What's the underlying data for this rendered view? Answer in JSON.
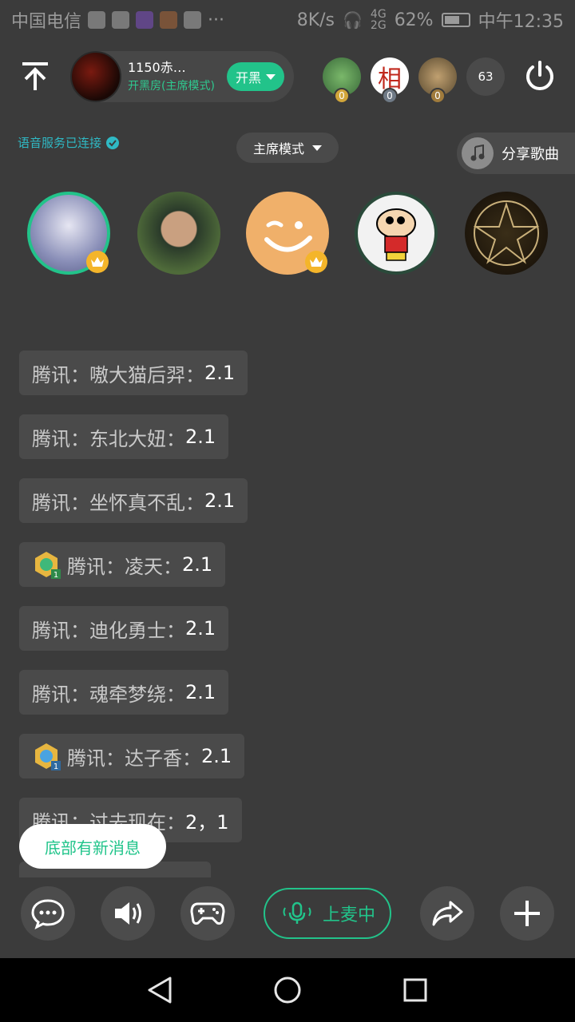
{
  "status_bar": {
    "carrier": "中国电信",
    "speed": "8K/s",
    "battery": "62%",
    "time": "中午12:35"
  },
  "room": {
    "title": "1150赤…",
    "subtitle": "开黑房(主席模式)",
    "open_button": "开黑"
  },
  "top_users": [
    {
      "badge": "0",
      "color": "#3a8c4a",
      "badge_color": "#d2a63a"
    },
    {
      "badge": "0",
      "color": "#ffffff",
      "badge_color": "#6f7a86",
      "char": "相"
    },
    {
      "badge": "0",
      "color": "#8a7d6a",
      "badge_color": "#a07b3c"
    }
  ],
  "online_count": "63",
  "voice_status": "语音服务已连接",
  "mode_select": "主席模式",
  "share_song": "分享歌曲",
  "seats": [
    {
      "bg": "#8a8fb8",
      "ring": "#22c38a",
      "crown": true
    },
    {
      "bg": "#4f6b3a",
      "ring": "none",
      "crown": false
    },
    {
      "bg": "#f0b06a",
      "ring": "none",
      "crown": true
    },
    {
      "bg": "#eeeeee",
      "ring": "#2a4a3a",
      "crown": false
    },
    {
      "bg": "#241b10",
      "ring": "none",
      "crown": false
    }
  ],
  "messages": [
    {
      "text": "腾讯：嗷大猫后羿：",
      "value": "2.1",
      "medal": false
    },
    {
      "text": "腾讯：东北大妞：",
      "value": "2.1",
      "medal": false
    },
    {
      "text": "腾讯：坐怀真不乱：",
      "value": "2.1",
      "medal": false
    },
    {
      "text": "腾讯：凌天：",
      "value": "2.1",
      "medal": true,
      "medal_color": "#3fb87a"
    },
    {
      "text": "腾讯：迪化勇士：",
      "value": "2.1",
      "medal": false
    },
    {
      "text": "腾讯：魂牵梦绕：",
      "value": "2.1",
      "medal": false
    },
    {
      "text": "腾讯：达子香：",
      "value": "2.1",
      "medal": true,
      "medal_color": "#4aa3e0"
    },
    {
      "text": "腾讯：过去现在：",
      "value": "2，1",
      "medal": false
    }
  ],
  "new_message_tip": "底部有新消息",
  "mic_button": "上麦中"
}
